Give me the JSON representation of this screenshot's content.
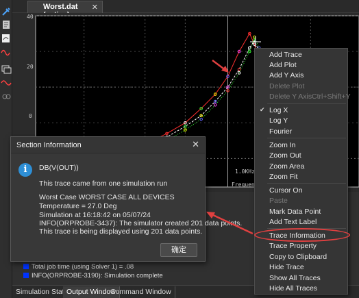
{
  "editor": {
    "tab_label": "Worst.dat (active)",
    "tab_close": "✕"
  },
  "toolbar": {
    "icons": [
      "probe-icon",
      "document-icon",
      "add-trace-icon",
      "waveform-icon",
      "windows-icon",
      "marker-icon",
      "link-icon"
    ]
  },
  "plot": {
    "x_axis": {
      "scale": "log",
      "visible_tick_label": "1.0KHz",
      "label_partial": "Frequenc"
    },
    "y_axis": {
      "tick_labels": [
        "40",
        "20",
        "0"
      ]
    },
    "grid": true,
    "background": "#000000",
    "trace_colors": [
      "#ff3030",
      "#ffffff",
      "#30ff30",
      "#ffff00",
      "#6060ff",
      "#ff40ff"
    ]
  },
  "chart_data": {
    "type": "line",
    "title": "",
    "xlabel": "Frequenc",
    "ylabel": "",
    "xscale": "log",
    "xlim": [
      200,
      3000
    ],
    "ylim": [
      -8,
      40
    ],
    "x_ticks": [
      "1.0KHz"
    ],
    "y_ticks": [
      40,
      20,
      0
    ],
    "series": [
      {
        "x": [
          200,
          300,
          400,
          500,
          600,
          700,
          800,
          900,
          1000,
          1100,
          1200,
          1250,
          1300,
          1350,
          1400,
          1500
        ],
        "y": [
          -5,
          -2,
          1,
          4,
          7,
          10,
          14,
          18,
          23,
          30,
          35,
          32,
          26,
          18,
          14,
          12
        ]
      },
      {
        "x": [
          200,
          300,
          400,
          500,
          600,
          700,
          800,
          900,
          1000,
          1100,
          1200,
          1250,
          1300,
          1350,
          1400,
          1500
        ],
        "y": [
          -6,
          -3,
          0,
          3,
          6,
          9,
          12,
          16,
          20,
          25,
          31,
          33,
          30,
          22,
          15,
          12
        ]
      },
      {
        "x": [
          200,
          300,
          400,
          500,
          600,
          700,
          800,
          900,
          1000,
          1100,
          1200,
          1250,
          1300,
          1350,
          1400,
          1500
        ],
        "y": [
          -6,
          -3,
          -1,
          2,
          5,
          8,
          11,
          15,
          19,
          24,
          30,
          34,
          31,
          23,
          16,
          12
        ]
      }
    ]
  },
  "dialog": {
    "title": "Section Information",
    "close": "✕",
    "icon": "info-icon",
    "lines": [
      "DB(V(OUT))",
      "This trace came from one simulation run",
      "Worst Case WORST CASE ALL DEVICES",
      "Temperature =  27.0 Deg",
      "Simulation at 16:18:42 on 05/07/24",
      "INFO(ORPROBE-3437): The simulator created 201 data points.",
      "This trace is being displayed using 201 data points."
    ],
    "ok_label": "确定"
  },
  "output": {
    "lines": [
      "Total job time (using Solver 1)   =      .08",
      "INFO(ORPROBE-3190): Simulation complete"
    ],
    "tabs": [
      "Simulation Status",
      "Output Window",
      "Command Window"
    ]
  },
  "context_menu": {
    "items": [
      {
        "label": "Add Trace",
        "enabled": true
      },
      {
        "label": "Add Plot",
        "enabled": true
      },
      {
        "label": "Add Y Axis",
        "enabled": true
      },
      {
        "label": "Delete Plot",
        "enabled": false
      },
      {
        "label": "Delete Y Axis",
        "enabled": false,
        "shortcut": "Ctrl+Shift+Y"
      },
      {
        "label": "Log X",
        "enabled": true,
        "checked": true
      },
      {
        "label": "Log Y",
        "enabled": true
      },
      {
        "label": "Fourier",
        "enabled": true
      },
      {
        "label": "Zoom In",
        "enabled": true
      },
      {
        "label": "Zoom Out",
        "enabled": true
      },
      {
        "label": "Zoom Area",
        "enabled": true
      },
      {
        "label": "Zoom Fit",
        "enabled": true
      },
      {
        "label": "Cursor On",
        "enabled": true
      },
      {
        "label": "Paste",
        "enabled": false
      },
      {
        "label": "Mark Data Point",
        "enabled": true
      },
      {
        "label": "Add Text Label",
        "enabled": true
      },
      {
        "label": "Trace Information",
        "enabled": true,
        "highlighted": true
      },
      {
        "label": "Trace Property",
        "enabled": true
      },
      {
        "label": "Copy to Clipboard",
        "enabled": true
      },
      {
        "label": "Hide Trace",
        "enabled": true
      },
      {
        "label": "Show All Traces",
        "enabled": true
      },
      {
        "label": "Hide All Traces",
        "enabled": true
      }
    ]
  },
  "colors": {
    "annotation_red": "#e04040",
    "info_blue": "#2e8fd6",
    "status_blue": "#0033ff"
  }
}
